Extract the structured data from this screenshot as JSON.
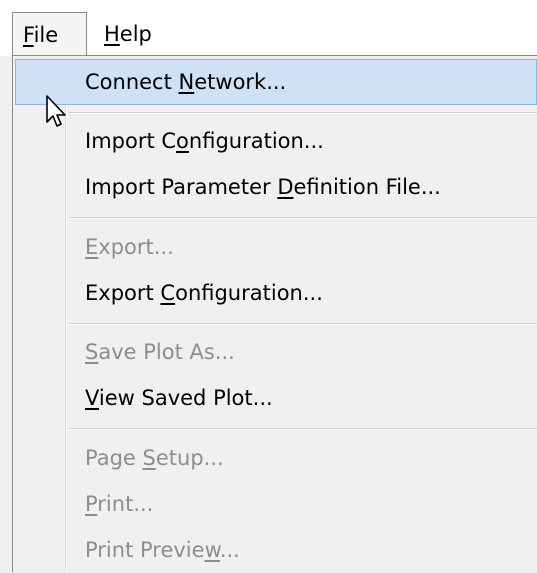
{
  "menubar": {
    "file": {
      "label_before": "",
      "accel": "F",
      "label_after": "ile"
    },
    "help": {
      "label_before": "",
      "accel": "H",
      "label_after": "elp"
    }
  },
  "file_menu": {
    "items": [
      {
        "before": "Connect ",
        "accel": "N",
        "after": "etwork...",
        "enabled": true,
        "highlighted": true
      },
      {
        "before": "Import C",
        "accel": "o",
        "after": "nfiguration...",
        "enabled": true
      },
      {
        "before": "Import Parameter ",
        "accel": "D",
        "after": "efinition File...",
        "enabled": true
      },
      {
        "before": "",
        "accel": "E",
        "after": "xport...",
        "enabled": false
      },
      {
        "before": "Export ",
        "accel": "C",
        "after": "onfiguration...",
        "enabled": true
      },
      {
        "before": "",
        "accel": "S",
        "after": "ave Plot As...",
        "enabled": false
      },
      {
        "before": "",
        "accel": "V",
        "after": "iew Saved Plot...",
        "enabled": true
      },
      {
        "before": "Page ",
        "accel": "S",
        "after": "etup...",
        "enabled": false
      },
      {
        "before": "",
        "accel": "P",
        "after": "rint...",
        "enabled": false
      },
      {
        "before": "Print Previe",
        "accel": "w",
        "after": "...",
        "enabled": false
      }
    ]
  },
  "colors": {
    "highlight_bg": "#cfe1f4",
    "highlight_border": "#8fb6e0",
    "disabled_text": "#8d8d8d"
  },
  "icons": {
    "cursor": "arrow-pointer-icon"
  }
}
